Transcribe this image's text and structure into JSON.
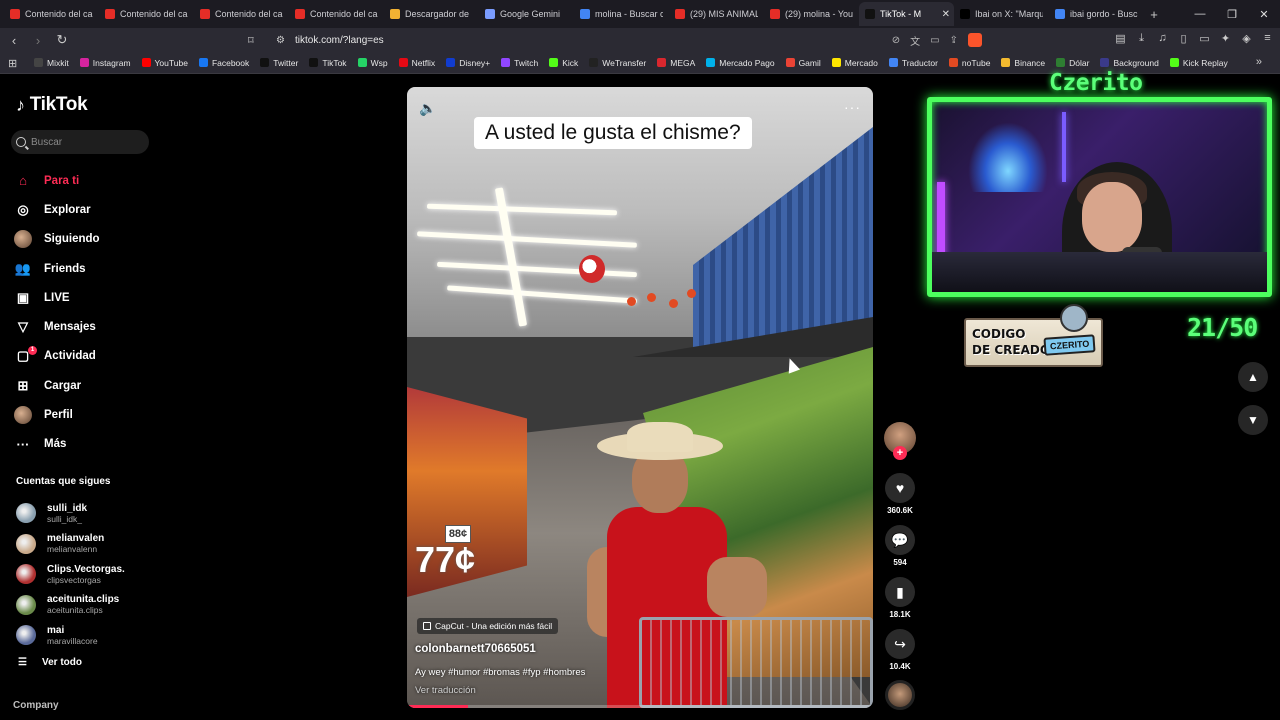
{
  "browser": {
    "tabs": [
      {
        "label": "Contenido del ca",
        "icon": "youtube-studio-icon",
        "color": "#e52d27"
      },
      {
        "label": "Contenido del ca",
        "icon": "youtube-studio-icon",
        "color": "#e52d27"
      },
      {
        "label": "Contenido del ca",
        "icon": "youtube-studio-icon",
        "color": "#e52d27"
      },
      {
        "label": "Contenido del ca",
        "icon": "youtube-studio-icon",
        "color": "#e52d27"
      },
      {
        "label": "Descargador de",
        "icon": "download-site-icon",
        "color": "#f2b233"
      },
      {
        "label": "Google Gemini",
        "icon": "gemini-icon",
        "color": "#7a9cff"
      },
      {
        "label": "molina - Buscar c",
        "icon": "google-icon",
        "color": "#4285f4"
      },
      {
        "label": "(29) MIS ANIMAL",
        "icon": "youtube-icon",
        "color": "#e52d27"
      },
      {
        "label": "(29) molina - You",
        "icon": "youtube-icon",
        "color": "#e52d27"
      },
      {
        "label": "TikTok - M",
        "icon": "tiktok-icon",
        "color": "#111111",
        "active": true
      },
      {
        "label": "Ibai on X: \"Marqu",
        "icon": "x-icon",
        "color": "#000000"
      },
      {
        "label": "ibai gordo - Busc",
        "icon": "google-icon",
        "color": "#4285f4"
      }
    ],
    "url": "tiktok.com/?lang=es",
    "bookmarks": [
      {
        "label": "Mixkit",
        "color": "#444444"
      },
      {
        "label": "Instagram",
        "color": "#d6249f"
      },
      {
        "label": "YouTube",
        "color": "#ff0000"
      },
      {
        "label": "Facebook",
        "color": "#1877f2"
      },
      {
        "label": "Twitter",
        "color": "#111111"
      },
      {
        "label": "TikTok",
        "color": "#111111"
      },
      {
        "label": "Wsp",
        "color": "#25d366"
      },
      {
        "label": "Netflix",
        "color": "#e50914"
      },
      {
        "label": "Disney+",
        "color": "#113ccf"
      },
      {
        "label": "Twitch",
        "color": "#9146ff"
      },
      {
        "label": "Kick",
        "color": "#53fc18"
      },
      {
        "label": "WeTransfer",
        "color": "#222222"
      },
      {
        "label": "MEGA",
        "color": "#d9272e"
      },
      {
        "label": "Mercado Pago",
        "color": "#00b1ea"
      },
      {
        "label": "Gamil",
        "color": "#ea4335"
      },
      {
        "label": "Mercado",
        "color": "#ffe600"
      },
      {
        "label": "Traductor",
        "color": "#4285f4"
      },
      {
        "label": "noTube",
        "color": "#e24a22"
      },
      {
        "label": "Binance",
        "color": "#f3ba2f"
      },
      {
        "label": "Dólar",
        "color": "#2e7d32"
      },
      {
        "label": "Background",
        "color": "#3a3a8a"
      },
      {
        "label": "Kick Replay",
        "color": "#53fc18"
      }
    ]
  },
  "tiktok": {
    "logo": "TikTok",
    "search_placeholder": "Buscar",
    "nav": [
      {
        "label": "Para ti",
        "icon": "home-icon",
        "glyph": "⌂",
        "active": true
      },
      {
        "label": "Explorar",
        "icon": "compass-icon",
        "glyph": "◎"
      },
      {
        "label": "Siguiendo",
        "icon": "following-avatar-icon",
        "glyph": ""
      },
      {
        "label": "Friends",
        "icon": "friends-icon",
        "glyph": "👥"
      },
      {
        "label": "LIVE",
        "icon": "live-icon",
        "glyph": "▣"
      },
      {
        "label": "Mensajes",
        "icon": "messages-icon",
        "glyph": "▽"
      },
      {
        "label": "Actividad",
        "icon": "activity-icon",
        "glyph": "▢",
        "badge": "1"
      },
      {
        "label": "Cargar",
        "icon": "upload-icon",
        "glyph": "⊞"
      },
      {
        "label": "Perfil",
        "icon": "profile-avatar-icon",
        "glyph": ""
      },
      {
        "label": "Más",
        "icon": "more-icon",
        "glyph": "···"
      }
    ],
    "following_title": "Cuentas que sigues",
    "following": [
      {
        "name": "sulli_idk",
        "handle": "sulli_idk_",
        "color": "#8aa0b0"
      },
      {
        "name": "melianvalen",
        "handle": "melianvalenn",
        "color": "#c9a98a"
      },
      {
        "name": "Clips.Vectorgas.",
        "handle": "clipsvectorgas",
        "color": "#b03030"
      },
      {
        "name": "aceitunita.clips",
        "handle": "aceitunita.clips",
        "color": "#6a8a4a"
      },
      {
        "name": "mai",
        "handle": "maravillacore",
        "color": "#5a6a9a"
      }
    ],
    "see_all": "Ver todo",
    "company": "Company"
  },
  "video": {
    "caption": "A usted le gusta el chisme?",
    "capcut_label": "CapCut - Una edición más fácil",
    "author": "colonbarnett70665051",
    "description": "Ay wey #humor #bromas #fyp #hombres",
    "translate": "Ver traducción",
    "price_tag": "88¢",
    "price_big": "77¢",
    "progress": 0.13,
    "likes": "360.6K",
    "comments": "594",
    "saves": "18.1K",
    "shares": "10.4K"
  },
  "overlay": {
    "streamer": "Czerito",
    "creator_code_line1": "CODIGO",
    "creator_code_line2": "DE CREADOR",
    "creator_code_tag": "CZERITO",
    "counter": "21/50"
  }
}
